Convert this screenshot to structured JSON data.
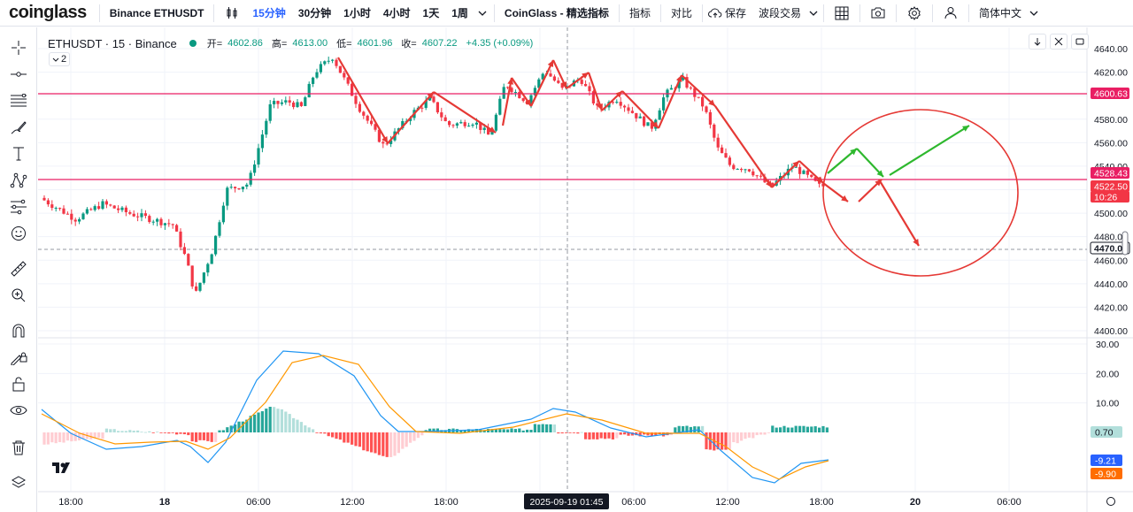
{
  "topbar": {
    "logo": "coinglass",
    "symbol": "Binance ETHUSDT",
    "intervals": [
      "15分钟",
      "30分钟",
      "1小时",
      "4小时",
      "1天",
      "1周"
    ],
    "active_interval": "15分钟",
    "indicator_brand": "CoinGlass - 精选指标",
    "indicators": "指标",
    "compare": "对比",
    "save": "保存",
    "wave": "波段交易",
    "language": "简体中文"
  },
  "legend": {
    "symbol": "ETHUSDT · 15 · Binance",
    "open_label": "开=",
    "open": "4602.86",
    "high_label": "高=",
    "high": "4613.00",
    "low_label": "低=",
    "low": "4601.96",
    "close_label": "收=",
    "close": "4607.22",
    "change": "+4.35 (+0.09%)",
    "collapse_count": "2"
  },
  "price_axis": {
    "ticks": [
      "4640.00",
      "4620.00",
      "4600.00",
      "4580.00",
      "4560.00",
      "4540.00",
      "4520.00",
      "4500.00",
      "4480.00",
      "4460.00",
      "4440.00",
      "4420.00",
      "4400.00"
    ],
    "labels": [
      {
        "text": "4600.63",
        "color": "#e91e63"
      },
      {
        "text": "4528.43",
        "color": "#e91e63"
      },
      {
        "text": "4522.50",
        "color": "#f23645"
      },
      {
        "text": "10:26",
        "color": "#f23645"
      },
      {
        "text": "4470.0",
        "color": "#131722"
      }
    ]
  },
  "macd_axis": {
    "ticks": [
      "30.00",
      "20.00",
      "10.00"
    ],
    "labels": [
      {
        "text": "0.70",
        "color": "#b2dfdb"
      },
      {
        "text": "-9.21",
        "color": "#2962ff"
      },
      {
        "text": "-9.90",
        "color": "#ff6d00"
      }
    ]
  },
  "time_axis": {
    "ticks": [
      "18:00",
      "18",
      "06:00",
      "12:00",
      "18:00",
      "06:00",
      "12:00",
      "18:00",
      "20",
      "06:00"
    ],
    "crosshair_label": "2025-09-19  01:45"
  },
  "colors": {
    "up": "#089981",
    "down": "#f23645",
    "hline": "#e91e63",
    "arrow_red": "#e53935",
    "arrow_green": "#2eb82e",
    "macd_line": "#2196f3",
    "signal_line": "#ff9800"
  },
  "icons": {
    "crosshair": "crosshair-icon",
    "trendline": "trendline-icon",
    "fib": "fib-icon",
    "brush": "brush-icon",
    "text": "text-icon",
    "pattern": "pattern-icon",
    "forecast": "forecast-icon",
    "emoji": "emoji-icon",
    "ruler": "ruler-icon",
    "zoom": "zoom-icon",
    "magnet": "magnet-icon",
    "lock_drawing": "lock-draw-icon",
    "lock": "lock-icon",
    "eye": "eye-icon",
    "trash": "trash-icon",
    "layers": "layers-icon"
  }
}
